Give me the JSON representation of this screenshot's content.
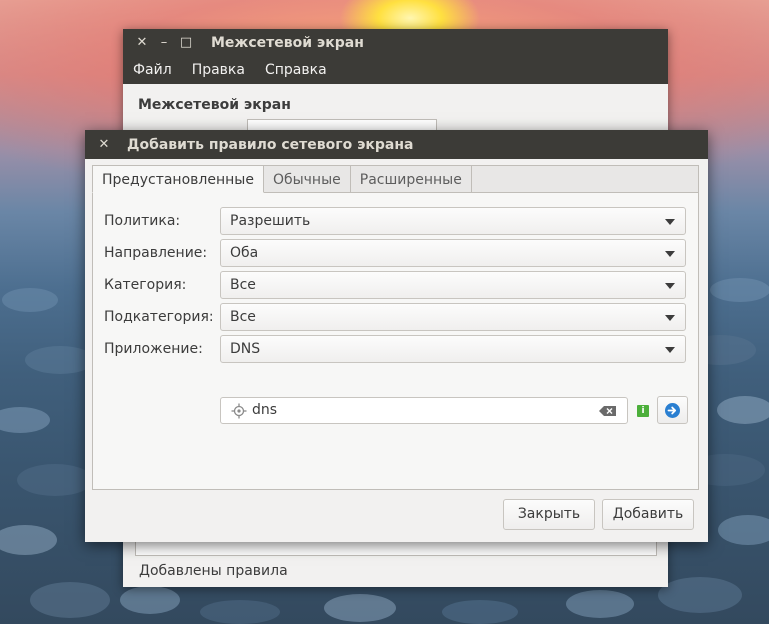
{
  "main_window": {
    "title": "Межсетевой экран",
    "controls": {
      "close": "✕",
      "minimize": "–",
      "maximize": "□"
    },
    "menu": [
      "Файл",
      "Правка",
      "Справка"
    ],
    "heading": "Межсетевой экран",
    "footer_label": "Добавлены правила"
  },
  "dialog": {
    "title": "Добавить правило сетевого экрана",
    "close_glyph": "✕",
    "tabs": [
      "Предустановленные",
      "Обычные",
      "Расширенные"
    ],
    "active_tab": "Предустановленные",
    "fields": {
      "policy": {
        "label": "Политика:",
        "value": "Разрешить"
      },
      "direction": {
        "label": "Направление:",
        "value": "Оба"
      },
      "category": {
        "label": "Категория:",
        "value": "Все"
      },
      "subcategory": {
        "label": "Подкатегория:",
        "value": "Все"
      },
      "application": {
        "label": "Приложение:",
        "value": "DNS"
      }
    },
    "search": {
      "value": "dns"
    },
    "info_glyph": "i",
    "buttons": {
      "close": "Закрыть",
      "add": "Добавить"
    }
  },
  "colors": {
    "titlebar": "#3c3b37",
    "window_bg": "#f2f1f0",
    "info_green": "#4caf3a",
    "go_blue": "#2a7fd1"
  },
  "icons": [
    "search-icon",
    "clear-icon",
    "info-icon",
    "go-arrow-icon",
    "chevron-down-icon",
    "close-icon",
    "minimize-icon",
    "maximize-icon"
  ]
}
